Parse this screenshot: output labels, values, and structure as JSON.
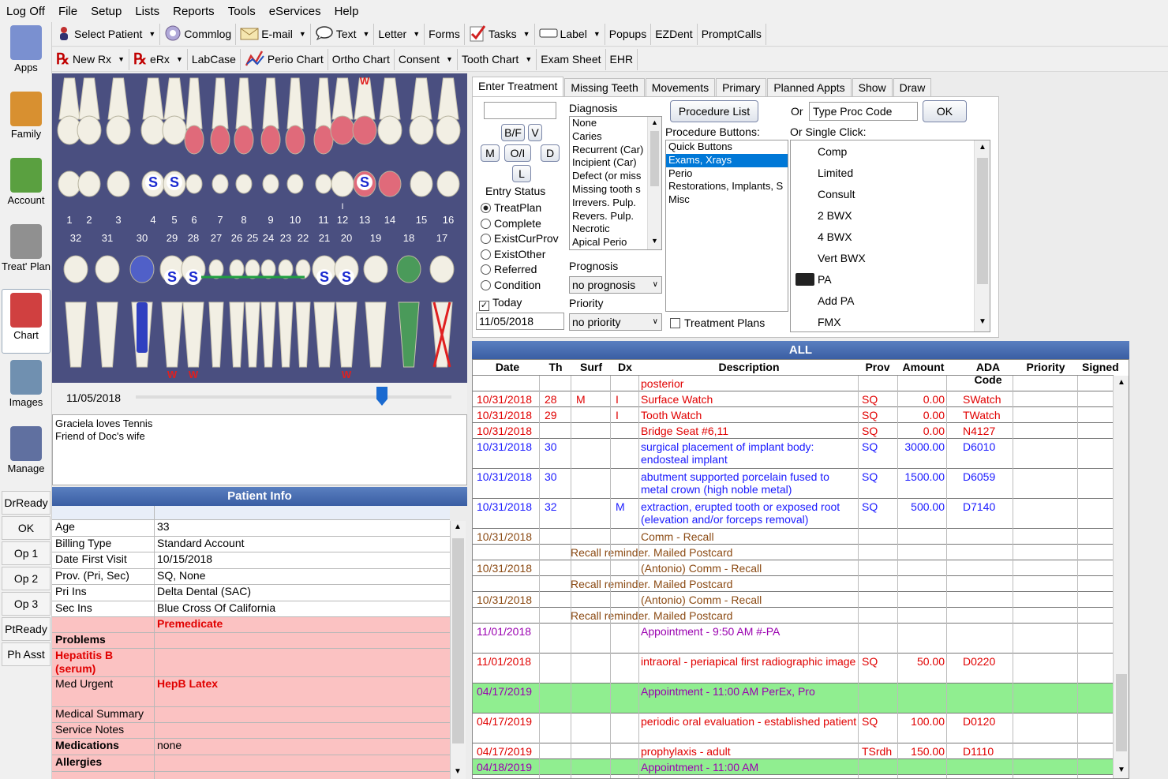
{
  "menu": [
    "Log Off",
    "File",
    "Setup",
    "Lists",
    "Reports",
    "Tools",
    "eServices",
    "Help"
  ],
  "toolbar1": [
    {
      "label": "Select Patient",
      "icon": "select-patient-icon",
      "dd": true
    },
    {
      "label": "Commlog",
      "icon": "commlog-icon",
      "dd": false
    },
    {
      "label": "E-mail",
      "icon": "email-icon",
      "dd": true
    },
    {
      "label": "Text",
      "icon": "text-bubble-icon",
      "dd": true
    },
    {
      "label": "Letter",
      "icon": "",
      "dd": true
    },
    {
      "label": "Forms",
      "icon": "",
      "dd": false
    },
    {
      "label": "Tasks",
      "icon": "tasks-icon",
      "dd": true
    },
    {
      "label": "Label",
      "icon": "label-icon",
      "dd": true
    },
    {
      "label": "Popups",
      "icon": "",
      "dd": false
    },
    {
      "label": "EZDent",
      "icon": "",
      "dd": false
    },
    {
      "label": "PromptCalls",
      "icon": "",
      "dd": false
    }
  ],
  "toolbar2": [
    {
      "label": "New Rx",
      "rx": true,
      "dd": true
    },
    {
      "label": "eRx",
      "rx": true,
      "dd": true
    },
    {
      "label": "LabCase",
      "rx": false,
      "dd": false
    },
    {
      "label": "Perio Chart",
      "rx": false,
      "dd": false,
      "icon": "perio-icon"
    },
    {
      "label": "Ortho Chart",
      "rx": false,
      "dd": false
    },
    {
      "label": "Consent",
      "rx": false,
      "dd": true
    },
    {
      "label": "Tooth Chart",
      "rx": false,
      "dd": true
    },
    {
      "label": "Exam Sheet",
      "rx": false,
      "dd": false
    },
    {
      "label": "EHR",
      "rx": false,
      "dd": false
    }
  ],
  "modules": [
    {
      "label": "Apps",
      "icon": "apps-icon",
      "color": "#7a90d0"
    },
    {
      "label": "Family",
      "icon": "family-icon",
      "color": "#d89030"
    },
    {
      "label": "Account",
      "icon": "account-icon",
      "color": "#5aa040"
    },
    {
      "label": "Treat' Plan",
      "icon": "treat-plan-icon",
      "color": "#909090"
    },
    {
      "label": "Chart",
      "icon": "chart-tooth-icon",
      "color": "#d04040"
    },
    {
      "label": "Images",
      "icon": "images-icon",
      "color": "#7090b0"
    },
    {
      "label": "Manage",
      "icon": "manage-gear-icon",
      "color": "#6070a0"
    }
  ],
  "statusButtons": [
    "DrReady",
    "OK",
    "Op 1",
    "Op 2",
    "Op 3",
    "PtReady",
    "Ph Asst"
  ],
  "upperNumbers": [
    "1",
    "2",
    "3",
    "4",
    "5",
    "6",
    "7",
    "8",
    "9",
    "10",
    "11",
    "12",
    "13",
    "14",
    "15",
    "16"
  ],
  "lowerNumbers": [
    "32",
    "31",
    "30",
    "29",
    "28",
    "27",
    "26",
    "25",
    "24",
    "23",
    "22",
    "21",
    "20",
    "19",
    "18",
    "17"
  ],
  "chartMarks": {
    "w": "W",
    "s": "S",
    "i": "I"
  },
  "chartDate": "11/05/2018",
  "chartSliderValue": 0.78,
  "notes": [
    "Graciela loves Tennis",
    "Friend of Doc's wife"
  ],
  "patientInfo": {
    "title": "Patient Info",
    "rows": [
      {
        "k": "Age",
        "v": "33"
      },
      {
        "k": "Billing Type",
        "v": "Standard Account"
      },
      {
        "k": "Date First Visit",
        "v": "10/15/2018"
      },
      {
        "k": "Prov. (Pri, Sec)",
        "v": "SQ, None"
      },
      {
        "k": "Pri Ins",
        "v": "Delta Dental (SAC)"
      },
      {
        "k": "Sec Ins",
        "v": "Blue Cross Of California"
      }
    ],
    "premedicate": "Premedicate",
    "problemsLabel": "Problems",
    "problem": "Hepatitis B (serum)",
    "medUrgentLabel": "Med Urgent",
    "medUrgent": "HepB Latex",
    "medicalSummary": "Medical Summary",
    "serviceNotes": "Service Notes",
    "medicationsLabel": "Medications",
    "medications": "none",
    "allergiesLabel": "Allergies"
  },
  "tabs": [
    "Enter Treatment",
    "Missing Teeth",
    "Movements",
    "Primary",
    "Planned Appts",
    "Show",
    "Draw"
  ],
  "treat": {
    "surfButtons": [
      "B/F",
      "V",
      "M",
      "O/I",
      "D",
      "L"
    ],
    "entryStatus": "Entry Status",
    "statuses": [
      "TreatPlan",
      "Complete",
      "ExistCurProv",
      "ExistOther",
      "Referred",
      "Condition"
    ],
    "todayLabel": "Today",
    "date": "11/05/2018",
    "diagnosisLabel": "Diagnosis",
    "diagnoses": [
      "None",
      "Caries",
      "Recurrent (Car)",
      "Incipient (Car)",
      "Defect (or miss",
      "Missing tooth s",
      "Irrevers. Pulp.",
      "Revers. Pulp.",
      "Necrotic",
      "Apical Perio"
    ],
    "prognosisLabel": "Prognosis",
    "prognosis": "no prognosis",
    "priorityLabel": "Priority",
    "priority": "no priority",
    "procListBtn": "Procedure List",
    "procButtonsLabel": "Procedure Buttons:",
    "procCats": [
      "Quick Buttons",
      "Exams, Xrays",
      "Perio",
      "Restorations, Implants, S",
      "Misc"
    ],
    "treatmentPlans": "Treatment Plans",
    "orLabel": "Or",
    "procCodePlaceholder": "Type Proc Code",
    "okBtn": "OK",
    "singleClickLabel": "Or Single Click:",
    "quick": [
      "Comp",
      "Limited",
      "Consult",
      "2 BWX",
      "4 BWX",
      "Vert BWX",
      "PA",
      "Add PA",
      "FMX"
    ]
  },
  "grid": {
    "title": "ALL",
    "columns": [
      "Date",
      "Th",
      "Surf",
      "Dx",
      "Description",
      "Prov",
      "Amount",
      "ADA Code",
      "Priority",
      "Signed"
    ],
    "rows": [
      {
        "desc": "posterior",
        "color": "red",
        "h": 20
      },
      {
        "date": "10/31/2018",
        "th": "28",
        "surf": "M",
        "dx": "I",
        "desc": "Surface Watch",
        "prov": "SQ",
        "amt": "0.00",
        "code": "SWatch",
        "color": "red",
        "h": 20
      },
      {
        "date": "10/31/2018",
        "th": "29",
        "dx": "I",
        "desc": "Tooth Watch",
        "prov": "SQ",
        "amt": "0.00",
        "code": "TWatch",
        "color": "red",
        "h": 20
      },
      {
        "date": "10/31/2018",
        "desc": "Bridge Seat #6,11",
        "prov": "SQ",
        "amt": "0.00",
        "code": "N4127",
        "color": "red",
        "h": 20
      },
      {
        "date": "10/31/2018",
        "th": "30",
        "desc": "surgical placement of implant body: endosteal implant",
        "prov": "SQ",
        "amt": "3000.00",
        "code": "D6010",
        "color": "blue",
        "h": 38
      },
      {
        "date": "10/31/2018",
        "th": "30",
        "desc": "abutment supported porcelain fused to metal crown (high noble metal)",
        "prov": "SQ",
        "amt": "1500.00",
        "code": "D6059",
        "color": "blue",
        "h": 38
      },
      {
        "date": "10/31/2018",
        "th": "32",
        "dx": "M",
        "desc": "extraction, erupted tooth or exposed root (elevation and/or forceps removal)",
        "prov": "SQ",
        "amt": "500.00",
        "code": "D7140",
        "color": "blue",
        "h": 38
      },
      {
        "date": "10/31/2018",
        "desc": "Comm - Recall",
        "color": "brown",
        "h": 20
      },
      {
        "wide": "Recall reminder.  Mailed Postcard",
        "color": "brown",
        "h": 20
      },
      {
        "date": "10/31/2018",
        "desc": "(Antonio) Comm - Recall",
        "color": "brown",
        "h": 20
      },
      {
        "wide": "Recall reminder.  Mailed Postcard",
        "color": "brown",
        "h": 20
      },
      {
        "date": "10/31/2018",
        "desc": "(Antonio) Comm - Recall",
        "color": "brown",
        "h": 20
      },
      {
        "wide": "Recall reminder.  Mailed Postcard",
        "color": "brown",
        "h": 20
      },
      {
        "date": "11/01/2018",
        "desc": "Appointment - 9:50 AM #-PA",
        "color": "purple",
        "h": 38
      },
      {
        "date": "11/01/2018",
        "desc": "intraoral - periapical first radiographic image",
        "prov": "SQ",
        "amt": "50.00",
        "code": "D0220",
        "color": "red",
        "h": 38
      },
      {
        "date": "04/17/2019",
        "desc": "Appointment - 11:00 AM PerEx, Pro",
        "color": "purple",
        "h": 38,
        "bg": "#90ee90"
      },
      {
        "date": "04/17/2019",
        "desc": "periodic oral evaluation - established patient",
        "prov": "SQ",
        "amt": "100.00",
        "code": "D0120",
        "color": "red",
        "h": 38
      },
      {
        "date": "04/17/2019",
        "desc": "prophylaxis - adult",
        "prov": "TSrdh",
        "amt": "150.00",
        "code": "D1110",
        "color": "red",
        "h": 20
      },
      {
        "date": "04/18/2019",
        "desc": "Appointment - 11:00 AM",
        "color": "purple",
        "h": 20,
        "bg": "#90ee90"
      }
    ]
  },
  "colors": {
    "red": "#e00000",
    "blue": "#1a1aff",
    "brown": "#8b4a13",
    "purple": "#9a00b0",
    "chartBg": "#4a4f80",
    "header": "#3a5ea3"
  }
}
